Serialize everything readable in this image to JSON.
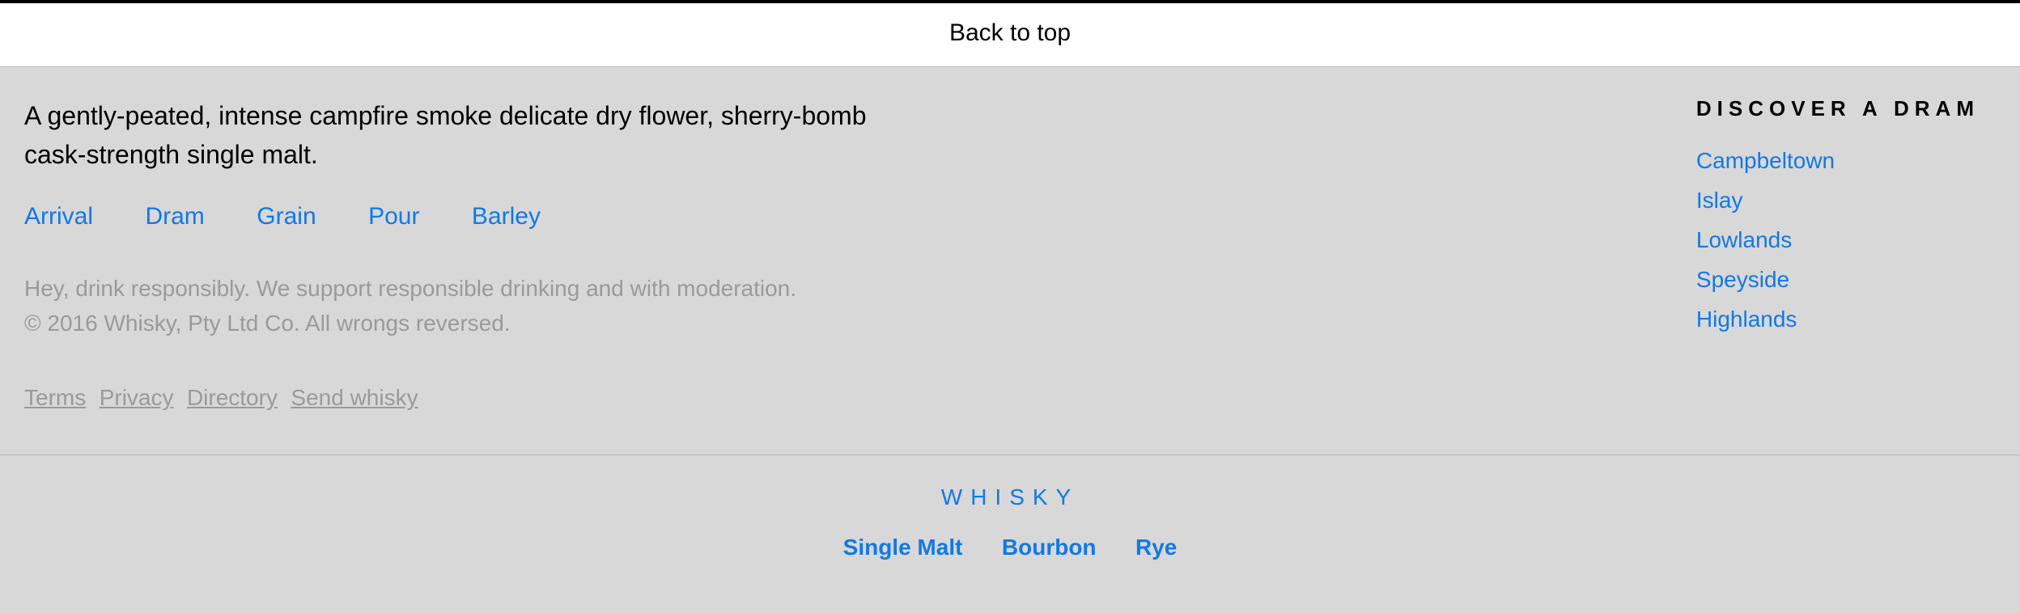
{
  "topbar": {
    "back_to_top": "Back to top"
  },
  "tagline": "A gently-peated, intense campfire smoke delicate dry flower, sherry-bomb cask-strength single malt.",
  "primary_nav": [
    "Arrival",
    "Dram",
    "Grain",
    "Pour",
    "Barley"
  ],
  "disclaimer_line1": "Hey, drink responsibly. We support responsible drinking and with moderation.",
  "disclaimer_line2": "© 2016 Whisky, Pty Ltd Co. All wrongs reversed.",
  "legal_links": [
    "Terms",
    "Privacy",
    "Directory",
    "Send whisky"
  ],
  "discover": {
    "heading": "DISCOVER A DRAM",
    "items": [
      "Campbeltown",
      "Islay",
      "Lowlands",
      "Speyside",
      "Highlands"
    ]
  },
  "brand": "WHISKY",
  "bottom_nav": [
    "Single Malt",
    "Bourbon",
    "Rye"
  ]
}
